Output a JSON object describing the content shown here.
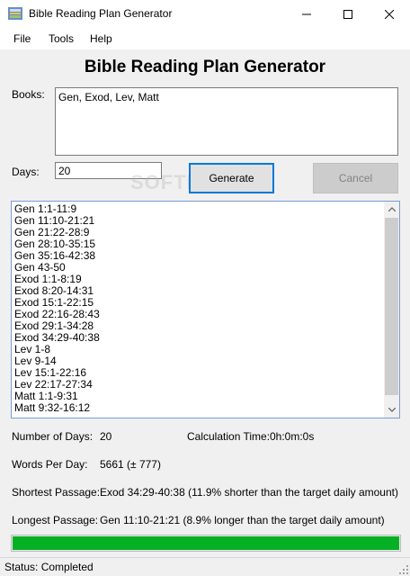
{
  "window": {
    "title": "Bible Reading Plan Generator"
  },
  "menu": {
    "file": "File",
    "tools": "Tools",
    "help": "Help"
  },
  "heading": "Bible Reading Plan Generator",
  "books": {
    "label": "Books:",
    "value": "Gen, Exod, Lev, Matt"
  },
  "days": {
    "label": "Days:",
    "value": "20"
  },
  "buttons": {
    "generate": "Generate",
    "cancel": "Cancel"
  },
  "watermark": "SOFTPEDIA",
  "passages": [
    "Gen 1:1-11:9",
    "Gen 11:10-21:21",
    "Gen 21:22-28:9",
    "Gen 28:10-35:15",
    "Gen 35:16-42:38",
    "Gen 43-50",
    "Exod 1:1-8:19",
    "Exod 8:20-14:31",
    "Exod 15:1-22:15",
    "Exod 22:16-28:43",
    "Exod 29:1-34:28",
    "Exod 34:29-40:38",
    "Lev 1-8",
    "Lev 9-14",
    "Lev 15:1-22:16",
    "Lev 22:17-27:34",
    "Matt 1:1-9:31",
    "Matt 9:32-16:12"
  ],
  "stats": {
    "num_days_label": "Number of Days:",
    "num_days_value": "20",
    "calc_time_label": "Calculation Time:",
    "calc_time_value": "0h:0m:0s",
    "words_label": "Words Per Day:",
    "words_value": "5661 (± 777)",
    "shortest_label": "Shortest Passage:",
    "shortest_value": "Exod 34:29-40:38 (11.9% shorter than the target daily amount)",
    "longest_label": "Longest Passage:",
    "longest_value": "Gen 11:10-21:21 (8.9% longer than the target daily amount)"
  },
  "progress": {
    "percent": 100,
    "color": "#06b025"
  },
  "status": "Status: Completed",
  "colors": {
    "accent": "#0078d7",
    "progress": "#06b025"
  },
  "icons": {
    "app": "app-icon",
    "minimize": "minimize-icon",
    "maximize": "maximize-icon",
    "close": "close-icon",
    "scroll_up": "chevron-up-icon",
    "scroll_down": "chevron-down-icon",
    "grip": "resize-grip-icon"
  }
}
